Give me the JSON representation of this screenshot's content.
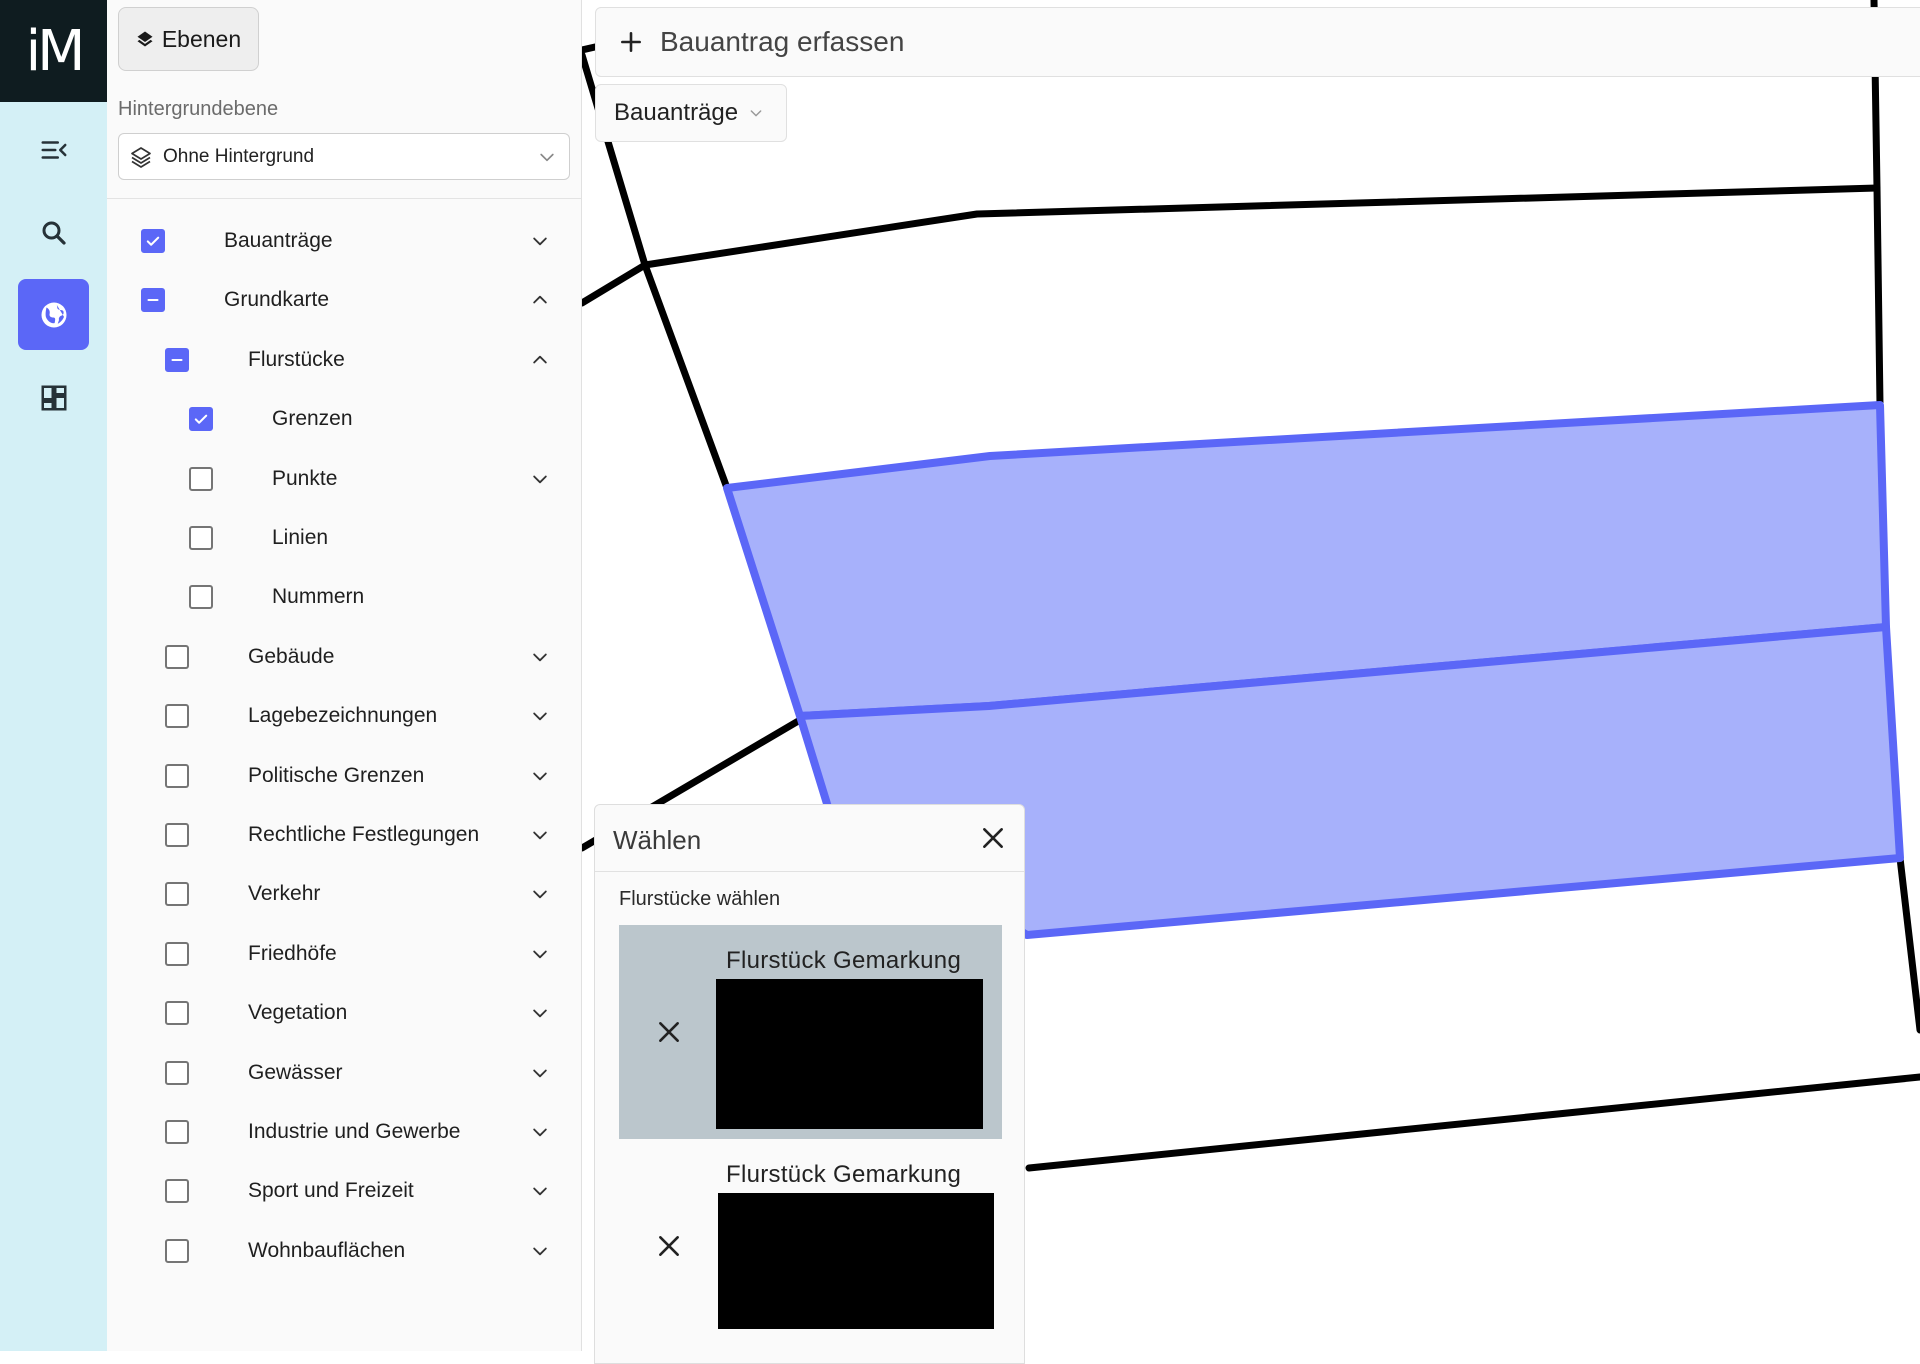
{
  "app": {
    "logo_text": "iM"
  },
  "rail": {
    "items": [
      {
        "name": "collapse-menu",
        "icon": "menu-collapse-icon",
        "active": false
      },
      {
        "name": "search",
        "icon": "search-icon",
        "active": false
      },
      {
        "name": "layers-map",
        "icon": "globe-icon",
        "active": true
      },
      {
        "name": "dashboard",
        "icon": "dashboard-icon",
        "active": false
      }
    ]
  },
  "panel": {
    "ebenen_label": "Ebenen",
    "background_label": "Hintergrundebene",
    "background_value": "Ohne Hintergrund",
    "layers": [
      {
        "label": "Bauanträge",
        "level": 0,
        "state": "checked",
        "expander": "down"
      },
      {
        "label": "Grundkarte",
        "level": 0,
        "state": "partial",
        "expander": "up"
      },
      {
        "label": "Flurstücke",
        "level": 1,
        "state": "partial",
        "expander": "up"
      },
      {
        "label": "Grenzen",
        "level": 2,
        "state": "checked",
        "expander": "none"
      },
      {
        "label": "Punkte",
        "level": 2,
        "state": "unchecked",
        "expander": "down"
      },
      {
        "label": "Linien",
        "level": 2,
        "state": "unchecked",
        "expander": "none"
      },
      {
        "label": "Nummern",
        "level": 2,
        "state": "unchecked",
        "expander": "none"
      },
      {
        "label": "Gebäude",
        "level": 1,
        "state": "unchecked",
        "expander": "down"
      },
      {
        "label": "Lagebezeichnungen",
        "level": 1,
        "state": "unchecked",
        "expander": "down"
      },
      {
        "label": "Politische Grenzen",
        "level": 1,
        "state": "unchecked",
        "expander": "down"
      },
      {
        "label": "Rechtliche Festlegungen",
        "level": 1,
        "state": "unchecked",
        "expander": "down"
      },
      {
        "label": "Verkehr",
        "level": 1,
        "state": "unchecked",
        "expander": "down"
      },
      {
        "label": "Friedhöfe",
        "level": 1,
        "state": "unchecked",
        "expander": "down"
      },
      {
        "label": "Vegetation",
        "level": 1,
        "state": "unchecked",
        "expander": "down"
      },
      {
        "label": "Gewässer",
        "level": 1,
        "state": "unchecked",
        "expander": "down"
      },
      {
        "label": "Industrie und Gewerbe",
        "level": 1,
        "state": "unchecked",
        "expander": "down"
      },
      {
        "label": "Sport und Freizeit",
        "level": 1,
        "state": "unchecked",
        "expander": "down"
      },
      {
        "label": "Wohnbauflächen",
        "level": 1,
        "state": "unchecked",
        "expander": "down"
      }
    ]
  },
  "map": {
    "create_label": "Bauantrag erfassen",
    "filter_label": "Bauanträge"
  },
  "dialog": {
    "title": "Wählen",
    "subtitle": "Flurstücke wählen",
    "items": [
      {
        "label": "Flurstück Gemarkung",
        "selected": true
      },
      {
        "label": "Flurstück Gemarkung",
        "selected": false
      }
    ]
  },
  "colors": {
    "accent": "#5b67f7",
    "parcel_fill": "#a7b1fb",
    "parcel_stroke": "#5b67f7",
    "rail_bg": "#d4f0f6",
    "logo_bg": "#0f1c20"
  }
}
